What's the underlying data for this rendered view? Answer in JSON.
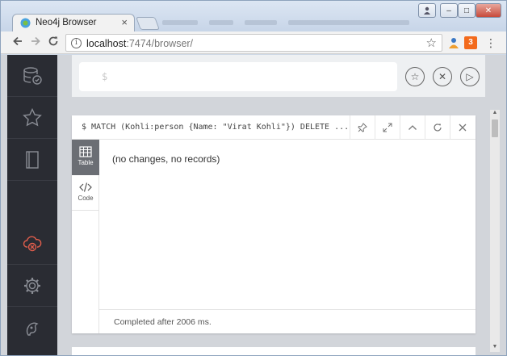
{
  "browser": {
    "tab_title": "Neo4j Browser",
    "tab_close": "×",
    "url_host": "localhost",
    "url_path": ":7474/browser/",
    "window_controls": {
      "minimize": "–",
      "maximize": "□",
      "close": "✕"
    },
    "menu_glyph": "⋮"
  },
  "sidebar": {
    "items": [
      {
        "name": "database-icon"
      },
      {
        "name": "favorites-star-icon"
      },
      {
        "name": "documents-book-icon"
      },
      {
        "name": "cloud-disconnected-icon",
        "color": "#e25e4c"
      },
      {
        "name": "settings-gear-icon"
      },
      {
        "name": "about-neo4j-icon"
      }
    ]
  },
  "editor": {
    "prompt": "$",
    "buttons": {
      "favorite": "☆",
      "clear": "✕",
      "run": "▷"
    }
  },
  "frame": {
    "query": "$ MATCH (Kohli:person {Name: \"Virat Kohli\"}) DELETE Kohli",
    "tabs": {
      "table": "Table",
      "code": "Code"
    },
    "result_message": "(no changes, no records)",
    "status_message": "Completed after 2006 ms."
  },
  "colors": {
    "sidebar_bg": "#2a2c33",
    "active_tab_bg": "#6b6e74",
    "alert_red": "#e25e4c"
  }
}
